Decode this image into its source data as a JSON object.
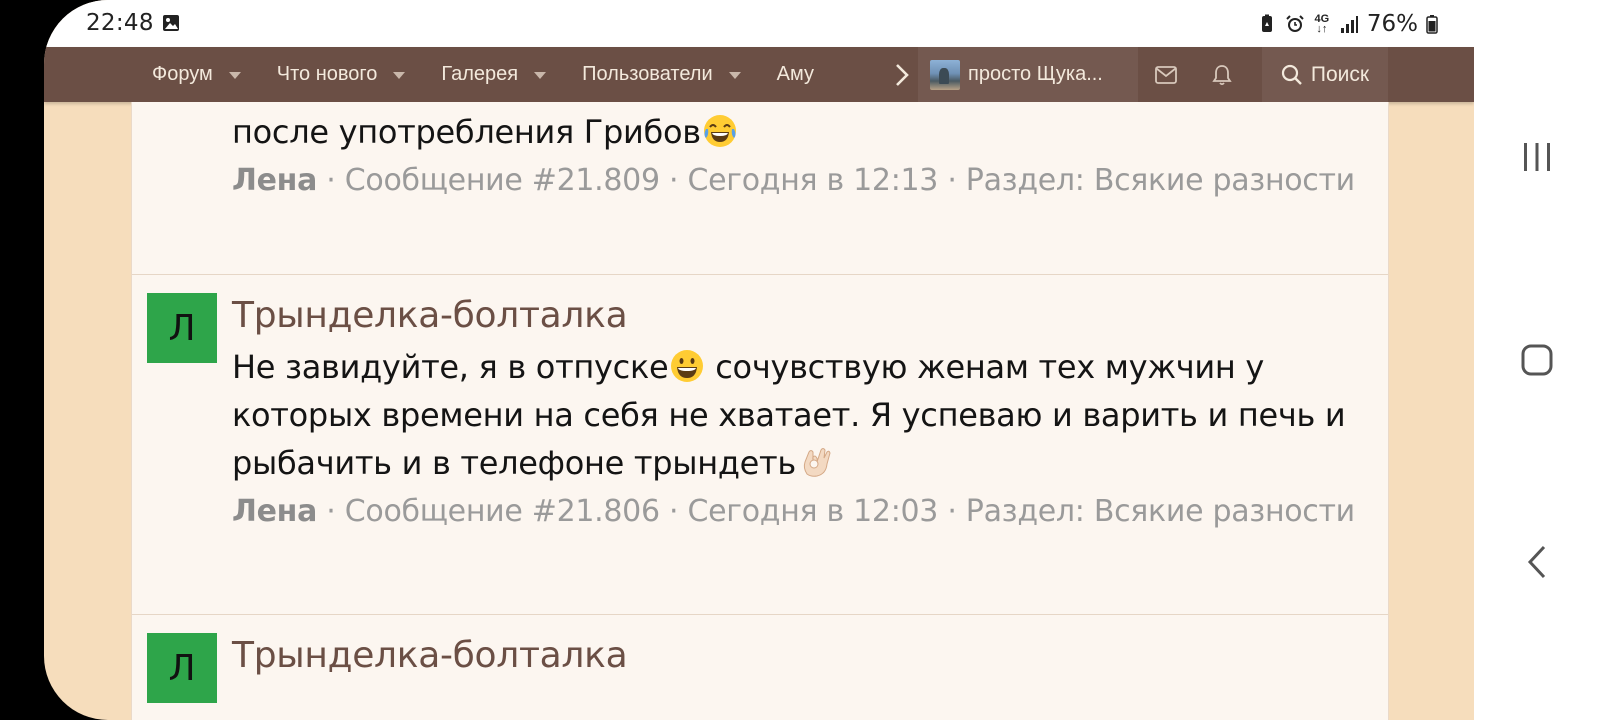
{
  "status_bar": {
    "time": "22:48",
    "network": "4G",
    "battery": "76%"
  },
  "navbar": {
    "items": [
      {
        "label": "Форум"
      },
      {
        "label": "Что нового"
      },
      {
        "label": "Галерея"
      },
      {
        "label": "Пользователи"
      },
      {
        "label": "Аму"
      }
    ],
    "user_name": "просто Щука...",
    "search_label": "Поиск"
  },
  "posts": {
    "partial": {
      "text": "после употребления Грибов",
      "emoji": "tears-of-joy-emoji",
      "author": "Лена",
      "meta": " · Сообщение #21.809 · Сегодня в 12:13 · Раздел: Всякие разности"
    },
    "items": [
      {
        "avatar_letter": "Л",
        "avatar_color": "#2ea54a",
        "title": "Трынделка-болталка",
        "text_before_emoji": "Не завидуйте, я в отпуске",
        "emoji1": "grinning-face-emoji",
        "text_after_emoji": " сочувствую женам тех мужчин у которых времени на себя не хватает. Я успеваю и варить и печь и рыбачить и в телефоне трындеть",
        "emoji2": "ok-hand-emoji",
        "author": "Лена",
        "meta": " · Сообщение #21.806 · Сегодня в 12:03 · Раздел: Всякие разности"
      },
      {
        "avatar_letter": "Л",
        "avatar_color": "#2ea54a",
        "title": "Трынделка-болталка"
      }
    ]
  },
  "colors": {
    "navbar_bg": "#6b4f45",
    "page_bg": "#f6ddbc",
    "panel_bg": "#fcf6f0",
    "title_color": "#6b4f45",
    "meta_color": "#9a9a9a"
  }
}
